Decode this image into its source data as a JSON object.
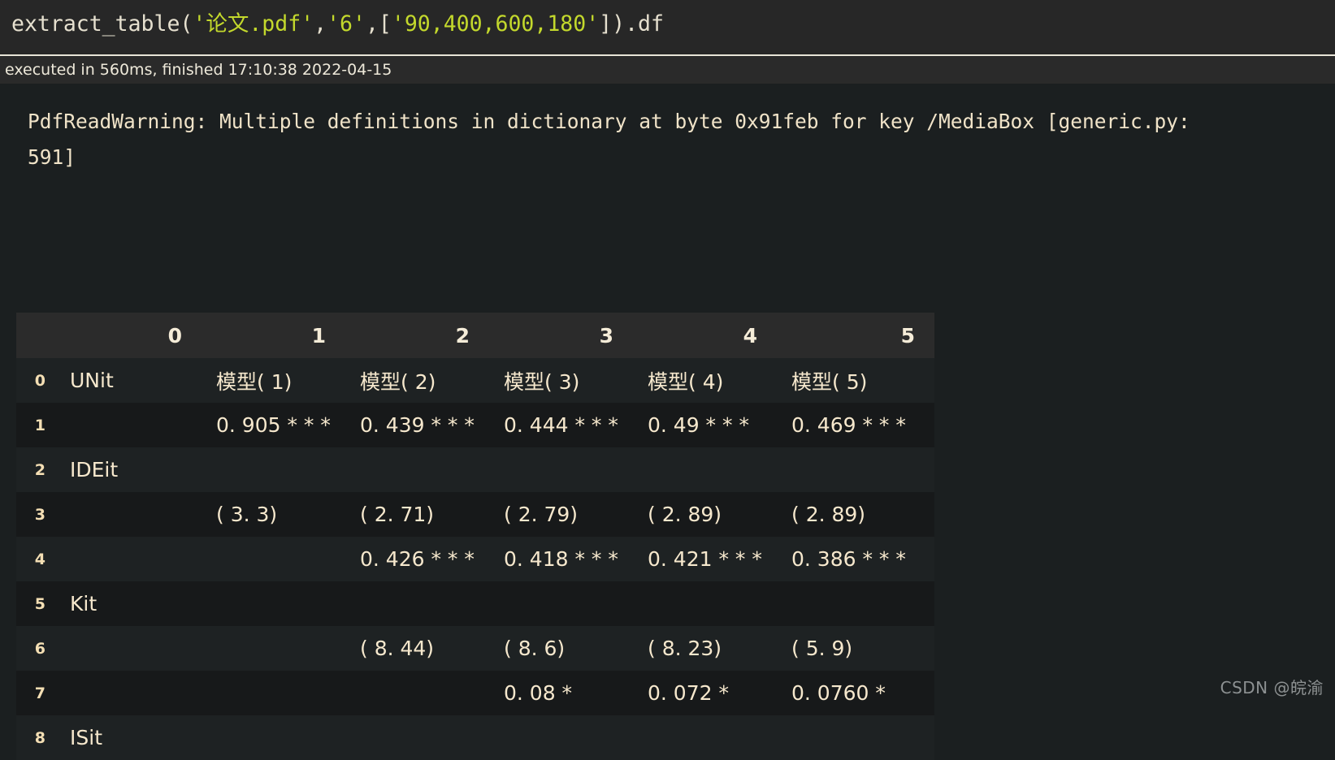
{
  "cell": {
    "code_segments": [
      {
        "text": "extract_table(",
        "kind": "plain"
      },
      {
        "text": "'论文.pdf'",
        "kind": "string"
      },
      {
        "text": ",",
        "kind": "plain"
      },
      {
        "text": "'6'",
        "kind": "string"
      },
      {
        "text": ",[",
        "kind": "plain"
      },
      {
        "text": "'90,400,600,180'",
        "kind": "string"
      },
      {
        "text": "]).df",
        "kind": "plain"
      }
    ],
    "code_full": "extract_table('论文.pdf','6',['90,400,600,180']).df",
    "execution_status": "executed in 560ms, finished 17:10:38 2022-04-15"
  },
  "output": {
    "warning_text": "PdfReadWarning: Multiple definitions in dictionary at byte 0x91feb for key /MediaBox [generic.py:591]"
  },
  "table": {
    "index_header": "",
    "columns": [
      "0",
      "1",
      "2",
      "3",
      "4",
      "5"
    ],
    "rows": [
      {
        "index": "0",
        "cells": [
          "UNit",
          "模型( 1)",
          "模型( 2)",
          "模型( 3)",
          "模型( 4)",
          "模型( 5)"
        ]
      },
      {
        "index": "1",
        "cells": [
          "",
          "0. 905 * * *",
          "0. 439 * * *",
          "0. 444 * * *",
          "0. 49 * * *",
          "0. 469 * * *"
        ]
      },
      {
        "index": "2",
        "cells": [
          "IDEit",
          "",
          "",
          "",
          "",
          ""
        ]
      },
      {
        "index": "3",
        "cells": [
          "",
          "( 3. 3)",
          "( 2. 71)",
          "( 2. 79)",
          "( 2. 89)",
          "( 2. 89)"
        ]
      },
      {
        "index": "4",
        "cells": [
          "",
          "",
          "0. 426 * * *",
          "0. 418 * * *",
          "0. 421 * * *",
          "0. 386 * * *"
        ]
      },
      {
        "index": "5",
        "cells": [
          "Kit",
          "",
          "",
          "",
          "",
          ""
        ]
      },
      {
        "index": "6",
        "cells": [
          "",
          "",
          "( 8. 44)",
          "( 8. 6)",
          "( 8. 23)",
          "( 5. 9)"
        ]
      },
      {
        "index": "7",
        "cells": [
          "",
          "",
          "",
          "0. 08 *",
          "0. 072 *",
          "0. 0760 *"
        ]
      },
      {
        "index": "8",
        "cells": [
          "ISit",
          "",
          "",
          "",
          "",
          ""
        ]
      }
    ]
  },
  "watermark": {
    "text": "CSDN @皖渝"
  },
  "colors": {
    "background": "#1b1f20",
    "code_background": "#272727",
    "exec_bar_background": "#2a2a2a",
    "string_token": "#c3d82c",
    "text": "#e6e0cf",
    "table_text": "#f6e8cd",
    "table_header_background": "#2b2b2b",
    "row_odd": "#17191a",
    "row_even": "#1e2223",
    "watermark": "#8d9192"
  }
}
